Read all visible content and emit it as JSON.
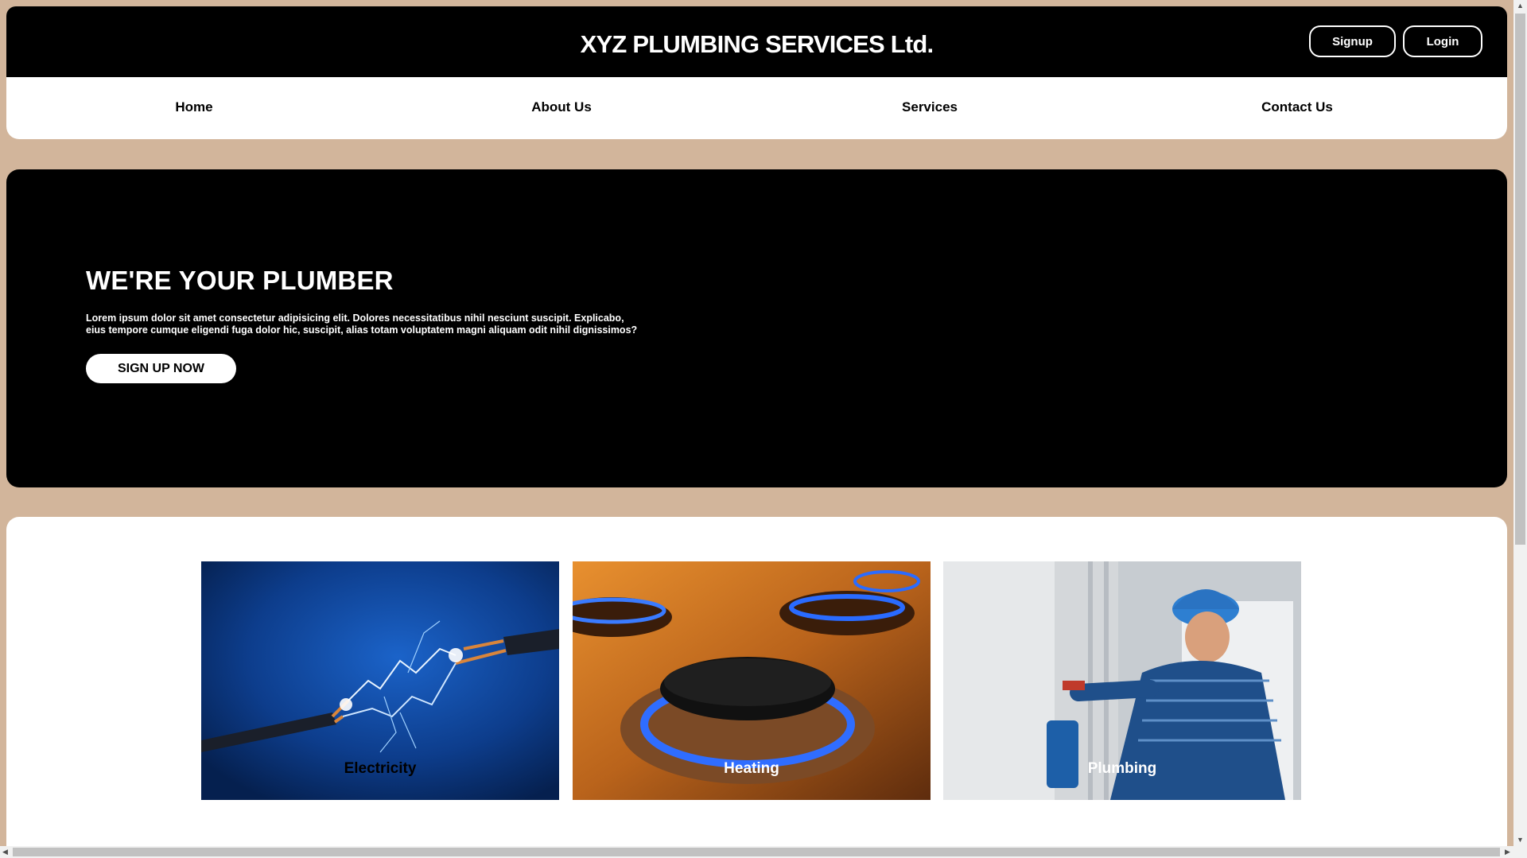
{
  "header": {
    "brand": "XYZ PLUMBING SERVICES Ltd.",
    "signup_label": "Signup",
    "login_label": "Login"
  },
  "nav": {
    "items": [
      {
        "label": "Home"
      },
      {
        "label": "About Us"
      },
      {
        "label": "Services"
      },
      {
        "label": "Contact Us"
      }
    ]
  },
  "hero": {
    "title": "WE'RE YOUR PLUMBER",
    "text": "Lorem ipsum dolor sit amet consectetur adipisicing elit. Dolores necessitatibus nihil nesciunt suscipit. Explicabo, eius tempore cumque eligendi fuga dolor hic, suscipit, alias totam voluptatem magni aliquam odit nihil dignissimos?",
    "cta_label": "SIGN UP NOW"
  },
  "services": {
    "cards": [
      {
        "label": "Electricity",
        "image": "electric-cable-spark-image"
      },
      {
        "label": "Heating",
        "image": "gas-burner-flame-image"
      },
      {
        "label": "Plumbing",
        "image": "plumber-working-image"
      }
    ]
  },
  "colors": {
    "page_background": "#d2b59b",
    "header_background": "#000000",
    "nav_background": "#ffffff"
  }
}
